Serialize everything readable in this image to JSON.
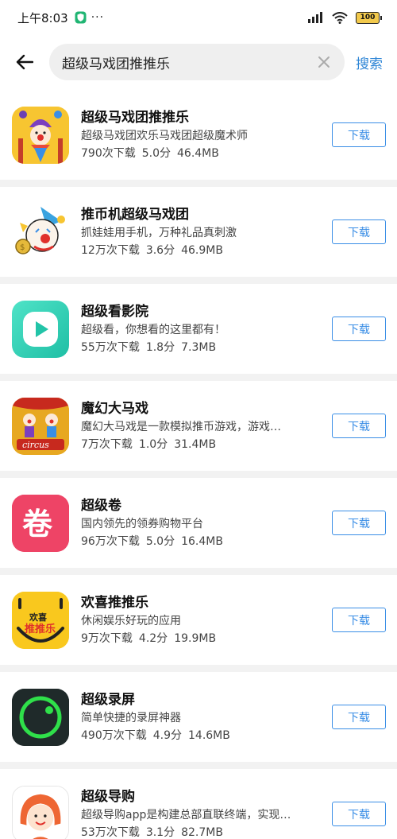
{
  "status": {
    "time": "上午8:03",
    "dots": "···",
    "battery": "100"
  },
  "search": {
    "query": "超级马戏团推推乐",
    "button": "搜索"
  },
  "download_label": "下载",
  "apps": [
    {
      "name": "超级马戏团推推乐",
      "desc": "超级马戏团欢乐马戏团超级魔术师",
      "downloads": "790次下载",
      "rating": "5.0分",
      "size": "46.4MB"
    },
    {
      "name": "推币机超级马戏团",
      "desc": "抓娃娃用手机，万种礼品真刺激",
      "downloads": "12万次下载",
      "rating": "3.6分",
      "size": "46.9MB"
    },
    {
      "name": "超级看影院",
      "desc": "超级看，你想看的这里都有！",
      "downloads": "55万次下载",
      "rating": "1.8分",
      "size": "7.3MB"
    },
    {
      "name": "魔幻大马戏",
      "desc": "魔幻大马戏是一款模拟推币游戏，游戏…",
      "downloads": "7万次下载",
      "rating": "1.0分",
      "size": "31.4MB",
      "icon_text": "circus"
    },
    {
      "name": "超级卷",
      "desc": "国内领先的领券购物平台",
      "downloads": "96万次下载",
      "rating": "5.0分",
      "size": "16.4MB",
      "icon_text": "卷"
    },
    {
      "name": "欢喜推推乐",
      "desc": "休闲娱乐好玩的应用",
      "downloads": "9万次下载",
      "rating": "4.2分",
      "size": "19.9MB",
      "icon_text_top": "欢喜",
      "icon_text_bottom": "推推乐"
    },
    {
      "name": "超级录屏",
      "desc": "简单快捷的录屏神器",
      "downloads": "490万次下载",
      "rating": "4.9分",
      "size": "14.6MB"
    },
    {
      "name": "超级导购",
      "desc": "超级导购app是构建总部直联终端，实现…",
      "downloads": "53万次下载",
      "rating": "3.1分",
      "size": "82.7MB"
    }
  ],
  "icons": [
    "clown-juggler-icon",
    "clown-face-icon",
    "play-icon",
    "circus-poster-icon",
    "juan-icon",
    "smiley-icon",
    "record-icon",
    "girl-avatar-icon"
  ],
  "colors": {
    "accent": "#3a8ee6",
    "search_bg": "#efefef"
  }
}
